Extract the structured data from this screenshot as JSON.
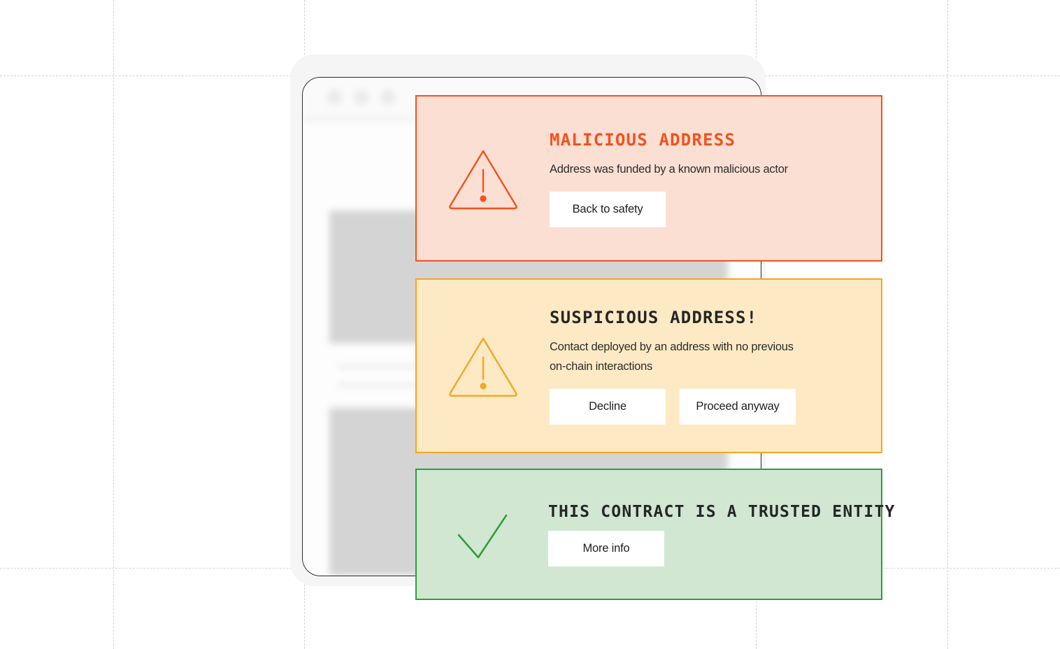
{
  "background": {
    "grid_color": "#d6d4d4",
    "vertical_lines": [
      162,
      435,
      1081,
      1355
    ],
    "horizontal_lines": [
      108,
      812
    ]
  },
  "browser_mockup": {
    "name": "blurred-browser-window",
    "traffic_light_dots": 3,
    "content_blocks": 2,
    "text_lines": 4
  },
  "cards": [
    {
      "id": "malicious",
      "icon": "warning-triangle-icon",
      "title": "MALICIOUS ADDRESS",
      "body": "Address was funded by a known malicious actor",
      "accent_color": "#f4511e",
      "background_color": "#fbdfd3",
      "title_color": "#f4511e",
      "buttons": [
        {
          "label": "Back to safety",
          "name": "back-to-safety-button"
        }
      ]
    },
    {
      "id": "suspicious",
      "icon": "warning-triangle-icon",
      "title": "SUSPICIOUS ADDRESS!",
      "body": "Contact deployed by an address with no previous on-chain interactions",
      "accent_color": "#f5a623",
      "background_color": "#fdeac4",
      "title_color": "#262626",
      "buttons": [
        {
          "label": "Decline",
          "name": "decline-button"
        },
        {
          "label": "Proceed anyway",
          "name": "proceed-anyway-button"
        }
      ]
    },
    {
      "id": "trusted",
      "icon": "checkmark-icon",
      "title": "THIS CONTRACT IS A TRUSTED ENTITY",
      "body": "",
      "accent_color": "#2e9e38",
      "background_color": "#d1e7d2",
      "title_color": "#262626",
      "buttons": [
        {
          "label": "More info",
          "name": "more-info-button"
        }
      ]
    }
  ]
}
